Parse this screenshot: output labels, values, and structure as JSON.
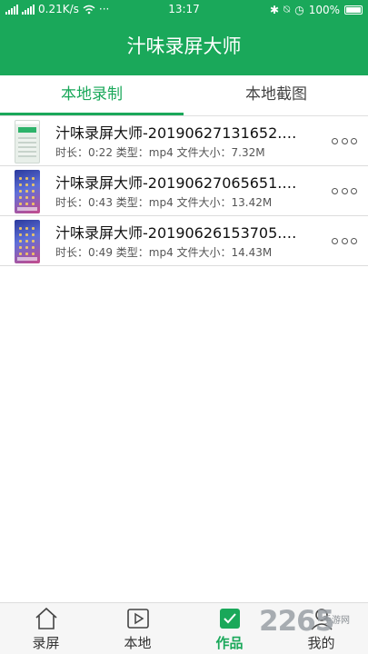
{
  "status_bar": {
    "network_speed": "0.21K/s",
    "more_dots": "···",
    "time": "13:17",
    "battery": "100%"
  },
  "header": {
    "title": "汁味录屏大师"
  },
  "tabs": [
    {
      "label": "本地录制",
      "active": true
    },
    {
      "label": "本地截图",
      "active": false
    }
  ],
  "recordings": [
    {
      "title": "汁味录屏大师-20190627131652.…",
      "meta": "时长：0:22 类型：mp4 文件大小：7.32M"
    },
    {
      "title": "汁味录屏大师-20190627065651.…",
      "meta": "时长：0:43 类型：mp4 文件大小：13.42M"
    },
    {
      "title": "汁味录屏大师-20190626153705.…",
      "meta": "时长：0:49 类型：mp4 文件大小：14.43M"
    }
  ],
  "bottom_nav": [
    {
      "label": "录屏",
      "icon": "home-icon",
      "active": false
    },
    {
      "label": "本地",
      "icon": "play-icon",
      "active": false
    },
    {
      "label": "作品",
      "icon": "works-icon",
      "active": true
    },
    {
      "label": "我的",
      "icon": "user-icon",
      "active": false
    }
  ],
  "watermark": {
    "brand": "2265",
    "sub": "手游网"
  },
  "colors": {
    "accent": "#1aa85a",
    "header_bg": "#1aa85a"
  }
}
